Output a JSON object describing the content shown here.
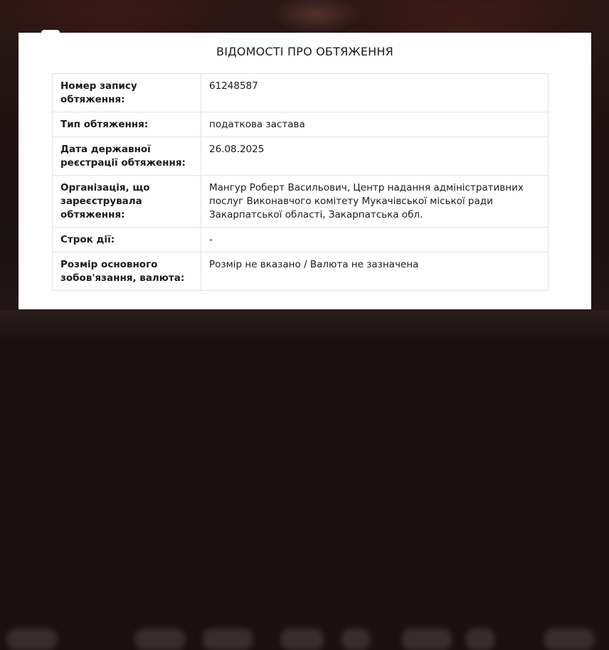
{
  "dialog": {
    "title": "ВІДОМОСТІ ПРО ОБТЯЖЕННЯ",
    "rows": [
      {
        "label": "Номер запису обтяження:",
        "value": "61248587"
      },
      {
        "label": "Тип обтяження:",
        "value": "податкова застава"
      },
      {
        "label": "Дата державної реєстрації обтяження:",
        "value": "26.08.2025"
      },
      {
        "label": "Організація, що зареєструвала обтяження:",
        "value": "Мангур Роберт Васильович, Центр надання адміністративних послуг Виконавчого комітету Мукачівської міської ради Закарпатської області, Закарпатська обл."
      },
      {
        "label": "Строк дії:",
        "value": "-"
      },
      {
        "label": "Розмір основного зобов'язання, валюта:",
        "value": "Розмір не вказано / Валюта не зазначена"
      }
    ]
  }
}
